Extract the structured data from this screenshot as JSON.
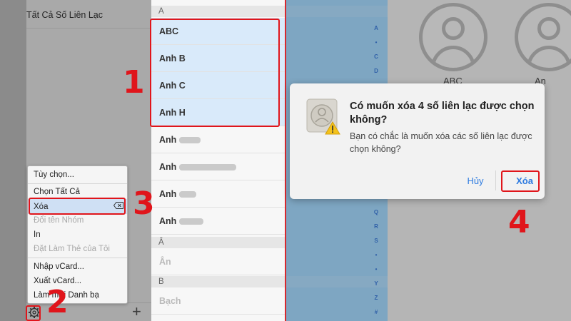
{
  "groups": {
    "header": "Tất Cả Số Liên Lạc",
    "gear_icon": "gear-icon",
    "plus_icon": "+"
  },
  "menu": {
    "items": [
      {
        "label": "Tùy chọn...",
        "enabled": true
      },
      {
        "label": "Chọn Tất Cả",
        "enabled": true
      },
      {
        "label": "Xóa",
        "enabled": true,
        "selected": true
      },
      {
        "label": "Đổi tên Nhóm",
        "enabled": false
      },
      {
        "label": "In",
        "enabled": true
      },
      {
        "label": "Đặt Làm Thẻ của Tôi",
        "enabled": false
      },
      {
        "label": "Nhập vCard...",
        "enabled": true
      },
      {
        "label": "Xuất vCard...",
        "enabled": true
      },
      {
        "label": "Làm mới Danh bạ",
        "enabled": true
      }
    ]
  },
  "contacts": {
    "sections": [
      {
        "header": "A",
        "rows": [
          "ABC",
          "Anh B",
          "Anh C",
          "Anh H",
          "Anh",
          "Anh",
          "Anh",
          "Anh"
        ]
      },
      {
        "header": "Â",
        "rows": [
          "Ân"
        ]
      },
      {
        "header": "B",
        "rows": [
          "Bạch"
        ]
      }
    ],
    "index_letters": [
      "A",
      "•",
      "C",
      "D",
      "Q",
      "R",
      "S",
      "•",
      "•",
      "Y",
      "Z",
      "#"
    ]
  },
  "details": {
    "avatar_names": [
      "ABC",
      "An"
    ]
  },
  "dialog": {
    "title": "Có muốn xóa 4 số liên lạc được chọn không?",
    "message": "Bạn có chắc là muốn xóa các số liên lạc được chọn không?",
    "cancel_label": "Hủy",
    "delete_label": "Xóa"
  },
  "annotations": {
    "step1": "1",
    "step2": "2",
    "step3": "3",
    "step4": "4",
    "color": "#e0151b"
  }
}
